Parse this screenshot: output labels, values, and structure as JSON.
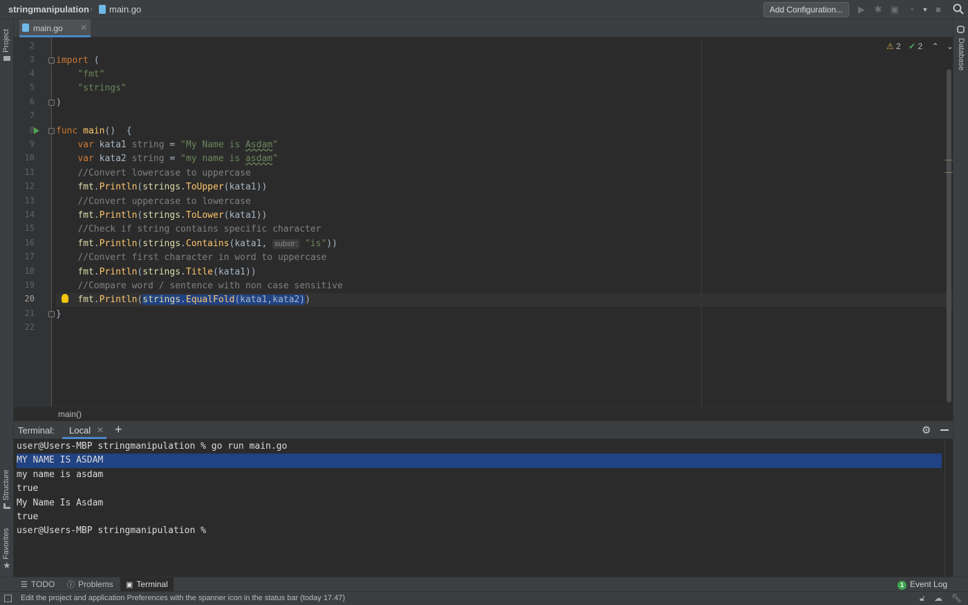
{
  "breadcrumb": {
    "project": "stringmanipulation",
    "file": "main.go"
  },
  "toolbar": {
    "add_configuration_label": "Add Configuration...",
    "icons": [
      "run-icon",
      "debug-icon",
      "coverage-icon",
      "profile-icon",
      "dropdown-icon",
      "stop-icon",
      "search-icon"
    ]
  },
  "left_strip": {
    "project_label": "Project",
    "structure_label": "Structure",
    "favorites_label": "Favorites"
  },
  "right_strip": {
    "database_label": "Database"
  },
  "editor_tab": {
    "label": "main.go"
  },
  "inspections": {
    "warnings": "2",
    "checks": "2"
  },
  "editor": {
    "line_numbers": [
      "2",
      "3",
      "4",
      "5",
      "6",
      "7",
      "8",
      "9",
      "10",
      "11",
      "12",
      "13",
      "14",
      "15",
      "16",
      "17",
      "18",
      "19",
      "20",
      "21",
      "22"
    ],
    "current_line": "20",
    "hint": "substr:",
    "breadcrumb_function": "main()"
  },
  "terminal": {
    "title": "Terminal:",
    "tab_label": "Local",
    "lines": [
      "user@Users-MBP stringmanipulation % go run main.go",
      "MY NAME IS ASDAM",
      "my name is asdam",
      "true",
      "My Name Is Asdam",
      "true",
      "user@Users-MBP stringmanipulation %"
    ]
  },
  "bottom_tools": {
    "todo": "TODO",
    "problems": "Problems",
    "terminal": "Terminal",
    "event_log": "Event Log",
    "event_count": "1"
  },
  "status": {
    "message": "Edit the project and application Preferences with the spanner icon in the status bar (today 17.47)"
  },
  "colors": {
    "keyword": "#cc7832",
    "string": "#6a8759",
    "comment": "#808080",
    "function": "#ffc66d",
    "selection": "#214283",
    "accent": "#4a88c7"
  }
}
